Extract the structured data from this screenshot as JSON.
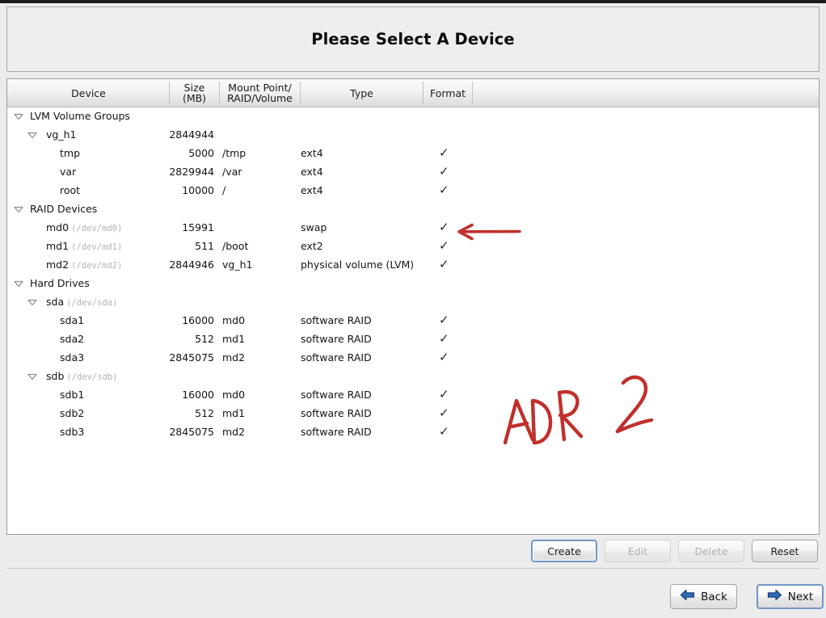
{
  "window": {
    "title": "Please Select A Device"
  },
  "table": {
    "headers": [
      {
        "label": "Device"
      },
      {
        "label": "Size\n(MB)",
        "line1": "Size",
        "line2": "(MB)"
      },
      {
        "label": "Mount Point/\nRAID/Volume",
        "line1": "Mount Point/",
        "line2": "RAID/Volume"
      },
      {
        "label": "Type"
      },
      {
        "label": "Format"
      }
    ],
    "rows": [
      {
        "indent": 0,
        "expander": "expanded",
        "device": "LVM Volume Groups",
        "path": "",
        "size": "",
        "mount": "",
        "type": "",
        "format": ""
      },
      {
        "indent": 1,
        "expander": "expanded",
        "device": "vg_h1",
        "path": "",
        "size": "2844944",
        "mount": "",
        "type": "",
        "format": ""
      },
      {
        "indent": 2,
        "expander": "none",
        "device": "tmp",
        "path": "",
        "size": "5000",
        "mount": "/tmp",
        "type": "ext4",
        "format": "✓"
      },
      {
        "indent": 2,
        "expander": "none",
        "device": "var",
        "path": "",
        "size": "2829944",
        "mount": "/var",
        "type": "ext4",
        "format": "✓"
      },
      {
        "indent": 2,
        "expander": "none",
        "device": "root",
        "path": "",
        "size": "10000",
        "mount": "/",
        "type": "ext4",
        "format": "✓"
      },
      {
        "indent": 0,
        "expander": "expanded",
        "device": "RAID Devices",
        "path": "",
        "size": "",
        "mount": "",
        "type": "",
        "format": ""
      },
      {
        "indent": 1,
        "expander": "none",
        "device": "md0",
        "path": "(/dev/md0)",
        "size": "15991",
        "mount": "",
        "type": "swap",
        "format": "✓"
      },
      {
        "indent": 1,
        "expander": "none",
        "device": "md1",
        "path": "(/dev/md1)",
        "size": "511",
        "mount": "/boot",
        "type": "ext2",
        "format": "✓"
      },
      {
        "indent": 1,
        "expander": "none",
        "device": "md2",
        "path": "(/dev/md2)",
        "size": "2844946",
        "mount": "vg_h1",
        "type": "physical volume (LVM)",
        "format": "✓"
      },
      {
        "indent": 0,
        "expander": "expanded",
        "device": "Hard Drives",
        "path": "",
        "size": "",
        "mount": "",
        "type": "",
        "format": ""
      },
      {
        "indent": 1,
        "expander": "expanded",
        "device": "sda",
        "path": "(/dev/sda)",
        "size": "",
        "mount": "",
        "type": "",
        "format": ""
      },
      {
        "indent": 2,
        "expander": "none",
        "device": "sda1",
        "path": "",
        "size": "16000",
        "mount": "md0",
        "type": "software RAID",
        "format": "✓"
      },
      {
        "indent": 2,
        "expander": "none",
        "device": "sda2",
        "path": "",
        "size": "512",
        "mount": "md1",
        "type": "software RAID",
        "format": "✓"
      },
      {
        "indent": 2,
        "expander": "none",
        "device": "sda3",
        "path": "",
        "size": "2845075",
        "mount": "md2",
        "type": "software RAID",
        "format": "✓"
      },
      {
        "indent": 1,
        "expander": "expanded",
        "device": "sdb",
        "path": "(/dev/sdb)",
        "size": "",
        "mount": "",
        "type": "",
        "format": ""
      },
      {
        "indent": 2,
        "expander": "none",
        "device": "sdb1",
        "path": "",
        "size": "16000",
        "mount": "md0",
        "type": "software RAID",
        "format": "✓"
      },
      {
        "indent": 2,
        "expander": "none",
        "device": "sdb2",
        "path": "",
        "size": "512",
        "mount": "md1",
        "type": "software RAID",
        "format": "✓"
      },
      {
        "indent": 2,
        "expander": "none",
        "device": "sdb3",
        "path": "",
        "size": "2845075",
        "mount": "md2",
        "type": "software RAID",
        "format": "✓"
      }
    ]
  },
  "actions": {
    "create": {
      "label": "Create",
      "enabled": true,
      "focused": true
    },
    "edit": {
      "label": "Edit",
      "enabled": false,
      "focused": false
    },
    "delete": {
      "label": "Delete",
      "enabled": false,
      "focused": false
    },
    "reset": {
      "label": "Reset",
      "enabled": true,
      "focused": false
    }
  },
  "navigation": {
    "back": {
      "label": "Back",
      "icon": "arrow-left-icon"
    },
    "next": {
      "label": "Next",
      "icon": "arrow-right-icon",
      "focused": true
    }
  },
  "annotations": {
    "color": "#c0302c",
    "arrow": {
      "name": "red-arrow-pointing-left",
      "target_row": "md0"
    },
    "handwriting": {
      "text": "ADR 2"
    }
  },
  "colors": {
    "accent_blue": "#2f6bb5",
    "annotation_red": "#c0302c",
    "panel_bg": "#eeeeee",
    "list_bg": "#ffffff"
  }
}
